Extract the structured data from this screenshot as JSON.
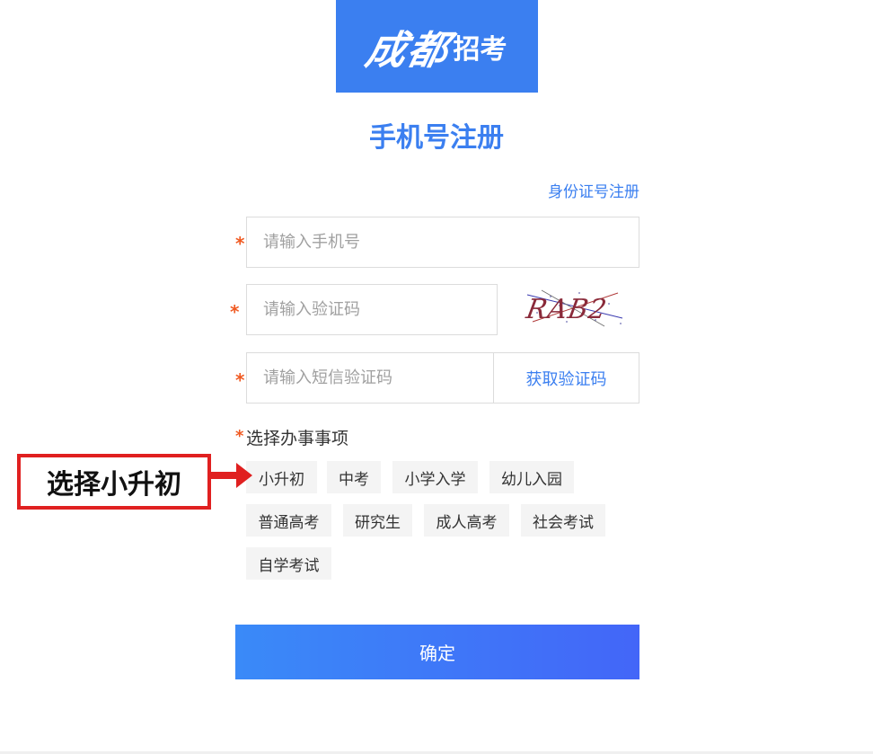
{
  "logo": {
    "brush_text": "成都",
    "rest_text": "招考"
  },
  "page_title": "手机号注册",
  "id_register_link": "身份证号注册",
  "fields": {
    "phone_placeholder": "请输入手机号",
    "captcha_placeholder": "请输入验证码",
    "sms_placeholder": "请输入短信验证码"
  },
  "captcha_text": "RAB2",
  "sms_button": "获取验证码",
  "required_mark": "*",
  "section": {
    "label": "选择办事事项"
  },
  "tags": [
    "小升初",
    "中考",
    "小学入学",
    "幼儿入园",
    "普通高考",
    "研究生",
    "成人高考",
    "社会考试",
    "自学考试"
  ],
  "annotation": "选择小升初",
  "confirm_button": "确定",
  "colors": {
    "brand": "#3b7ff0",
    "required": "#f05a22",
    "annotation": "#e02020"
  }
}
